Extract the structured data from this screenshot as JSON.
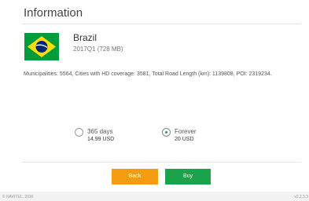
{
  "header": {
    "title": "Information"
  },
  "map": {
    "country": "Brazil",
    "version": "2017Q1 (728 MB)",
    "flag_icon": "brazil-flag-icon",
    "details": "Municipalities: 5564, Cities with HD coverage: 3581, Total Road Length (km): 1139808, POI: 2319234."
  },
  "plans": [
    {
      "label": "365 days",
      "price": "14.99 USD",
      "selected": false
    },
    {
      "label": "Forever",
      "price": "20 USD",
      "selected": true
    }
  ],
  "buttons": {
    "back_label": "Back",
    "buy_label": "Buy"
  },
  "colors": {
    "accent_green": "#1aa34a",
    "back_orange": "#f39c12"
  },
  "footer": {
    "copyright": "© NAVITEL, 2016",
    "app_version": "v2.2.3.3"
  }
}
